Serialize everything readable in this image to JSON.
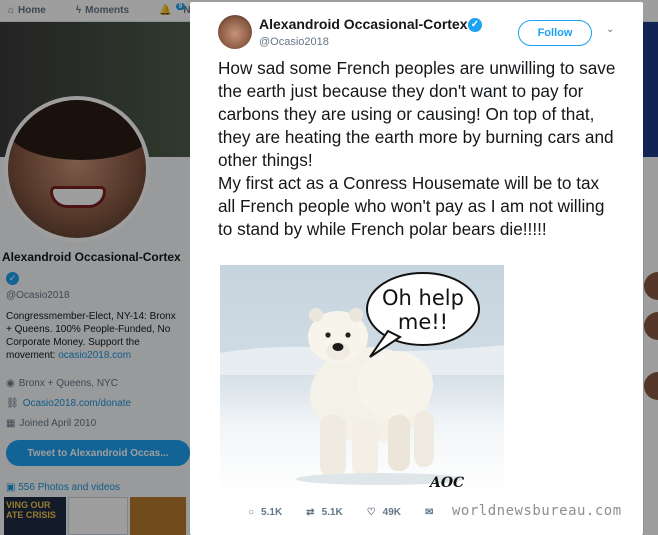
{
  "nav": {
    "home": "Home",
    "moments": "Moments",
    "notifications": "Notif",
    "notifications_badge": "9"
  },
  "profile": {
    "name": "Alexandroid Occasional-Cortex",
    "handle": "@Ocasio2018",
    "bio": "Congressmember-Elect, NY-14: Bronx + Queens. 100% People-Funded, No Corporate Money. Support the movement:",
    "bio_link": "ocasio2018.com",
    "location": "Bronx + Queens, NYC",
    "website": "Ocasio2018.com/donate",
    "joined": "Joined April 2010",
    "tweet_to_button": "Tweet to Alexandroid Occas...",
    "photos_label": "556 Photos and videos",
    "thumb1_text": "VING OUR\nATE CRISIS"
  },
  "tweet": {
    "author_name": "Alexandroid Occasional-Cortex",
    "author_handle": "@Ocasio2018",
    "follow_label": "Follow",
    "text": "How sad some French peoples are unwilling to save the earth just because they don't want to pay for carbons they are using or causing! On top of that, they are heating the earth more by burning cars and other things!\nMy first act as a Conress Housemate will be to tax all French people who won't pay as I am not willing to stand by while French polar bears die!!!!!",
    "image": {
      "speech_bubble_text_line1": "Oh help",
      "speech_bubble_text_line2": "me!!",
      "signature": "AOC"
    },
    "replies": "5.1K",
    "retweets": "5.1K",
    "likes": "49K"
  },
  "watermark": "worldnewsbureau.com",
  "colors": {
    "accent": "#1da1f2",
    "link": "#1b95e0",
    "muted": "#657786"
  }
}
